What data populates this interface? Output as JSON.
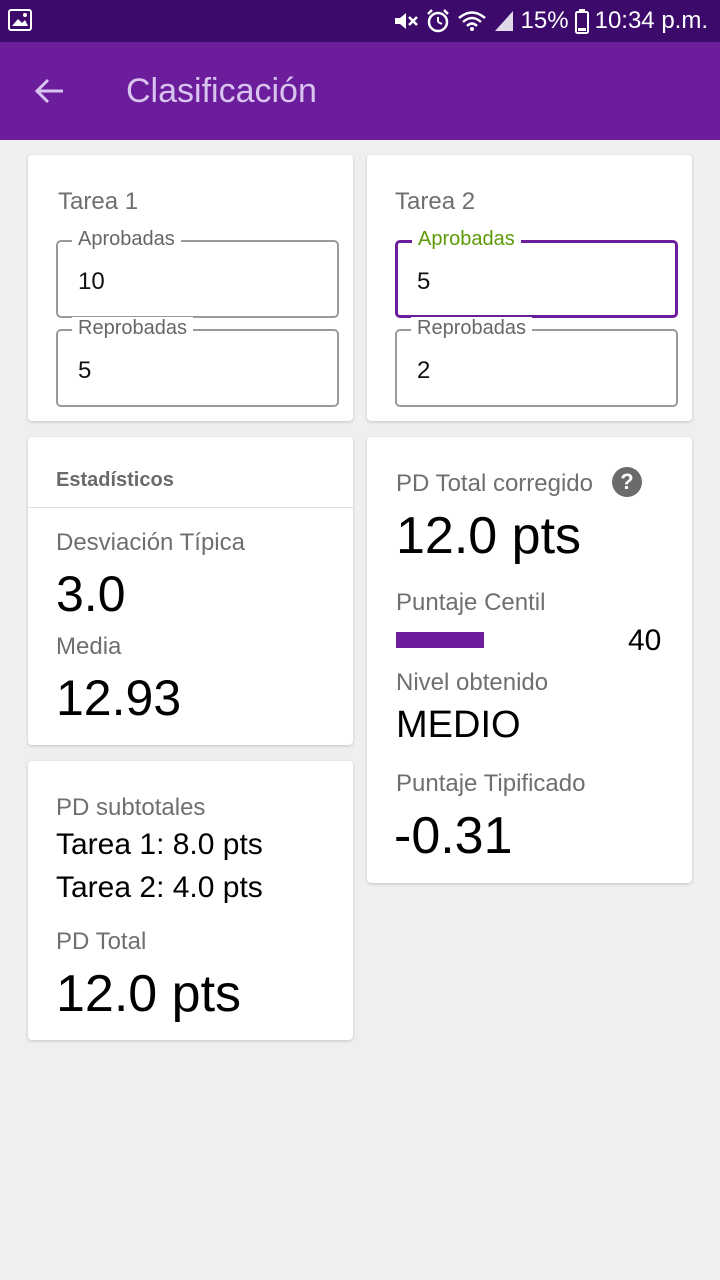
{
  "status_bar": {
    "battery": "15%",
    "time": "10:34 p.m.",
    "icons": [
      "gallery-icon",
      "mute-icon",
      "alarm-icon",
      "wifi-icon",
      "signal-icon",
      "battery-icon"
    ]
  },
  "app_bar": {
    "title": "Clasificación",
    "back_icon": "arrow-left-icon"
  },
  "tarea1": {
    "title": "Tarea 1",
    "aprobadas": {
      "label": "Aprobadas",
      "value": "10"
    },
    "reprobadas": {
      "label": "Reprobadas",
      "value": "5"
    }
  },
  "tarea2": {
    "title": "Tarea 2",
    "aprobadas": {
      "label": "Aprobadas",
      "value": "5"
    },
    "reprobadas": {
      "label": "Reprobadas",
      "value": "2"
    }
  },
  "estadisticos": {
    "header": "Estadísticos",
    "desviacion_label": "Desviación Típica",
    "desviacion_value": "3.0",
    "media_label": "Media",
    "media_value": "12.93"
  },
  "subtotales": {
    "label": "PD subtotales",
    "tarea1": "Tarea 1: 8.0 pts",
    "tarea2": "Tarea 2: 4.0 pts",
    "total_label": "PD Total",
    "total_value": "12.0 pts"
  },
  "resultado": {
    "pd_corregido_label": "PD Total corregido",
    "help_icon": "help-icon",
    "pd_corregido_value": "12.0 pts",
    "centil_label": "Puntaje Centil",
    "centil_value": "40",
    "centil_percent": 40,
    "nivel_label": "Nivel obtenido",
    "nivel_value": "MEDIO",
    "tipificado_label": "Puntaje Tipificado",
    "tipificado_value": "-0.31"
  },
  "colors": {
    "primary": "#6b1d9c",
    "status_bar": "#3b0a6b",
    "focus_label": "#5d9a08"
  }
}
